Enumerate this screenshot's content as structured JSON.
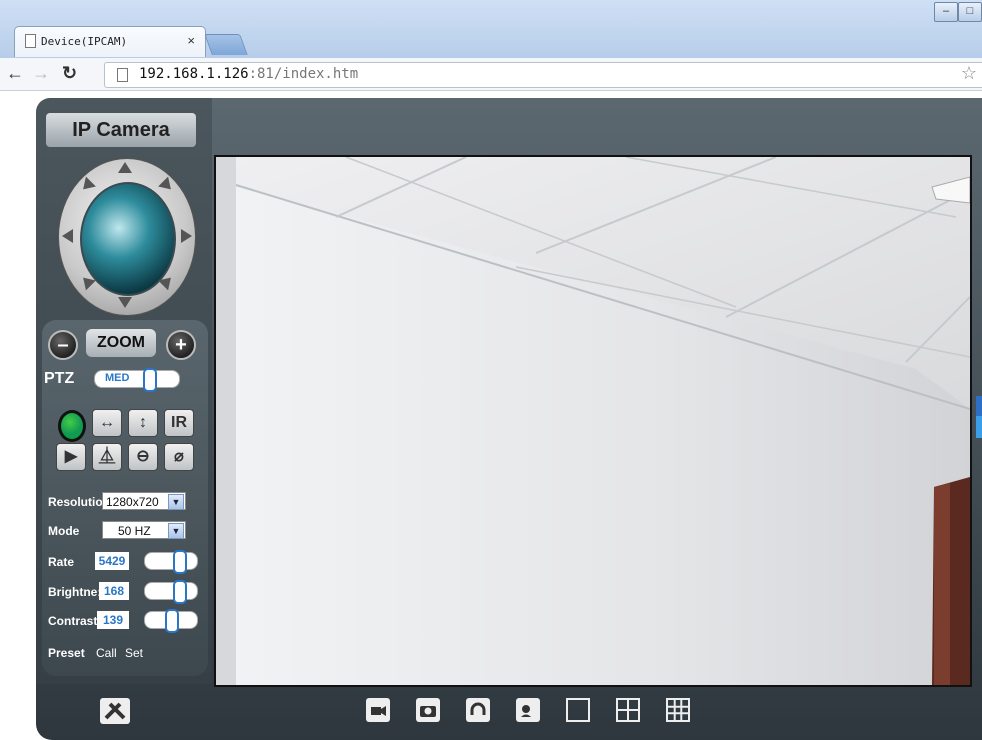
{
  "browser": {
    "tab_title": "Device(IPCAM)",
    "tab_close": "×",
    "url_host": "192.168.1.126",
    "url_rest": ":81/index.htm",
    "win_minimize": "–",
    "win_maximize": "□"
  },
  "app": {
    "logo": "IP Camera",
    "zoom_label": "ZOOM",
    "zoom_minus": "–",
    "zoom_plus": "+",
    "ptz_label": "PTZ",
    "ptz_speed": "MED",
    "ir_label": "IR",
    "settings": [
      {
        "label": "Resolutio",
        "value": "1280x720"
      },
      {
        "label": "Mode",
        "value": "50 HZ"
      }
    ],
    "sliders": [
      {
        "label": "Rate",
        "value": "5429"
      },
      {
        "label": "Brightne:",
        "value": "168"
      },
      {
        "label": "Contrast",
        "value": "139"
      }
    ],
    "preset_label": "Preset",
    "call_label": "Call",
    "set_label": "Set"
  },
  "colors": {
    "accent": "#2a77c7",
    "panel": "#3d484e",
    "status_green": "#22aa44"
  },
  "icons": {
    "settings": "tools-icon",
    "record": "video-record-icon",
    "snapshot": "camera-icon",
    "audio": "headphones-icon",
    "talk": "microphone-icon",
    "layout1": "single-view-icon",
    "layout4": "quad-view-icon",
    "layout9": "nine-view-icon"
  }
}
